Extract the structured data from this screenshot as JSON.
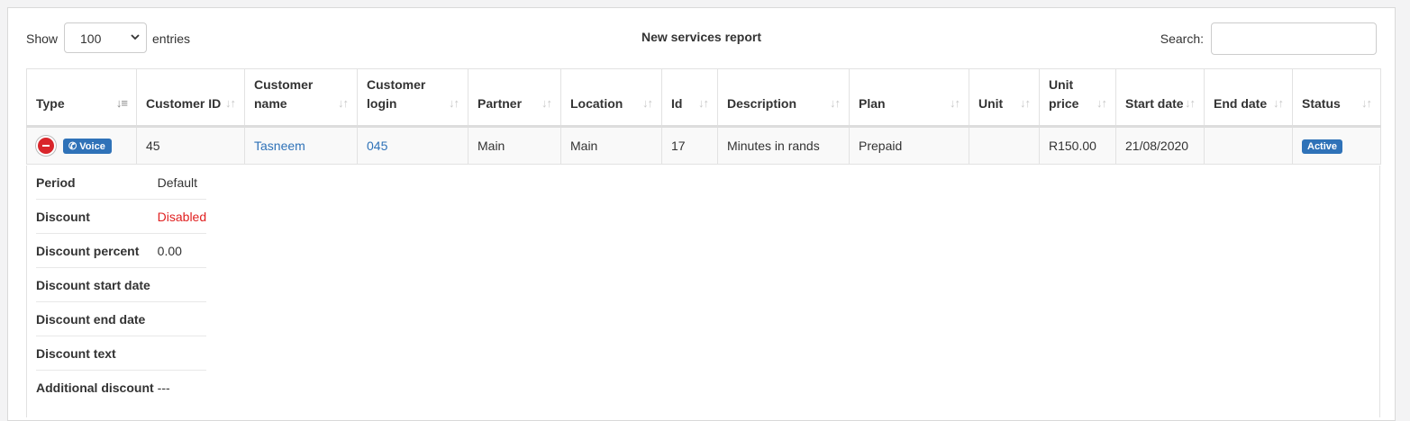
{
  "controls": {
    "show_label": "Show",
    "page_length": "100",
    "entries_label": "entries",
    "report_title": "New services report",
    "search_label": "Search:",
    "search_value": ""
  },
  "table": {
    "columns": [
      "Type",
      "Customer ID",
      "Customer name",
      "Customer login",
      "Partner",
      "Location",
      "Id",
      "Description",
      "Plan",
      "Unit",
      "Unit price",
      "Start date",
      "End date",
      "Status"
    ],
    "rows": [
      {
        "type_badge": "Voice",
        "customer_id": "45",
        "customer_name": "Tasneem",
        "customer_login": "045",
        "partner": "Main",
        "location": "Main",
        "id": "17",
        "description": "Minutes in rands",
        "plan": "Prepaid",
        "unit": "",
        "unit_price": "R150.00",
        "start_date": "21/08/2020",
        "end_date": "",
        "status": "Active"
      }
    ]
  },
  "details": [
    {
      "key": "Period",
      "value": "Default"
    },
    {
      "key": "Discount",
      "value": "Disabled"
    },
    {
      "key": "Discount percent",
      "value": "0.00"
    },
    {
      "key": "Discount start date",
      "value": ""
    },
    {
      "key": "Discount end date",
      "value": ""
    },
    {
      "key": "Discount text",
      "value": ""
    },
    {
      "key": "Additional discount",
      "value": "---"
    }
  ],
  "colors": {
    "accent": "#2f72b8",
    "danger": "#d9262b",
    "disabled_text": "#e02020"
  }
}
